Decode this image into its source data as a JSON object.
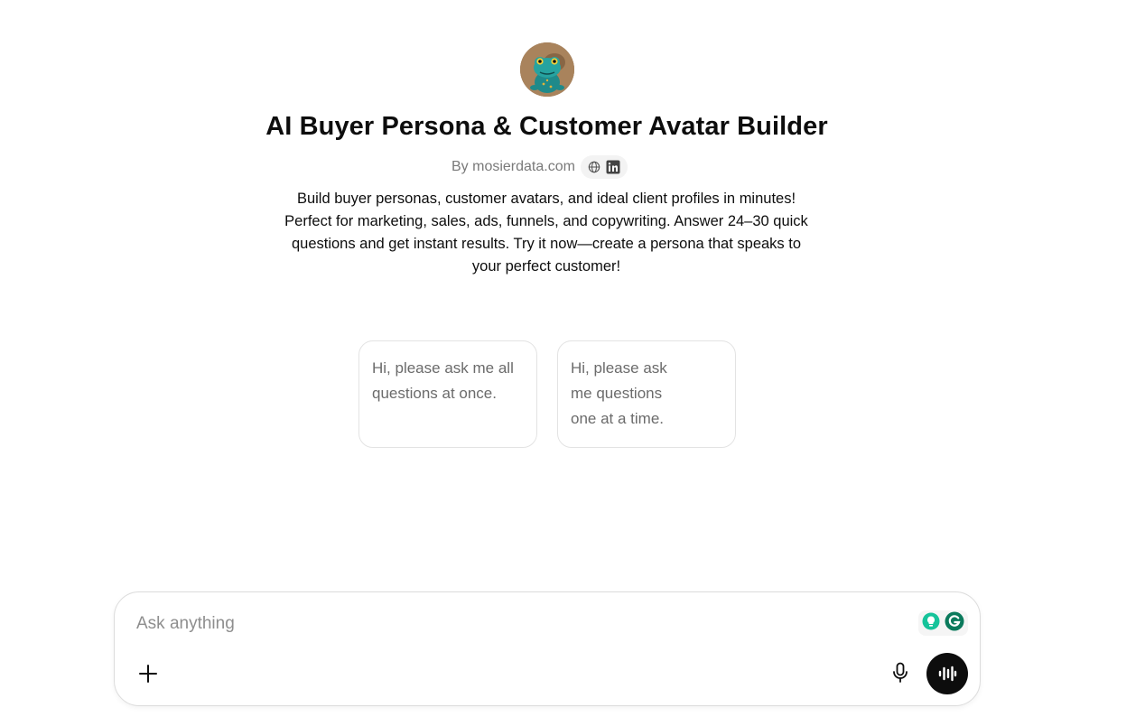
{
  "gpt": {
    "title": "AI Buyer Persona & Customer Avatar Builder",
    "author": "By mosierdata.com",
    "links": [
      {
        "icon": "globe-icon"
      },
      {
        "icon": "linkedin-icon"
      }
    ],
    "description": "Build buyer personas, customer avatars, and ideal client profiles in minutes! Perfect for marketing, sales, ads, funnels, and copywriting. Answer 24–30 quick questions and get instant results. Try it now—create a persona that speaks to your perfect customer!"
  },
  "starters": [
    {
      "text": "Hi, please ask me all questions at once."
    },
    {
      "text": "Hi, please ask me questions one at a time."
    }
  ],
  "composer": {
    "placeholder": "Ask anything",
    "icons": {
      "add": "plus-icon",
      "mic": "microphone-icon",
      "voice": "voice-mode-icon",
      "grammarly": "grammarly-icon",
      "idea": "lightbulb-icon"
    }
  },
  "colors": {
    "accent_dark": "#0d0d0d",
    "grammarly_green": "#15c39a",
    "grammarly_dark": "#0b7a5c"
  }
}
